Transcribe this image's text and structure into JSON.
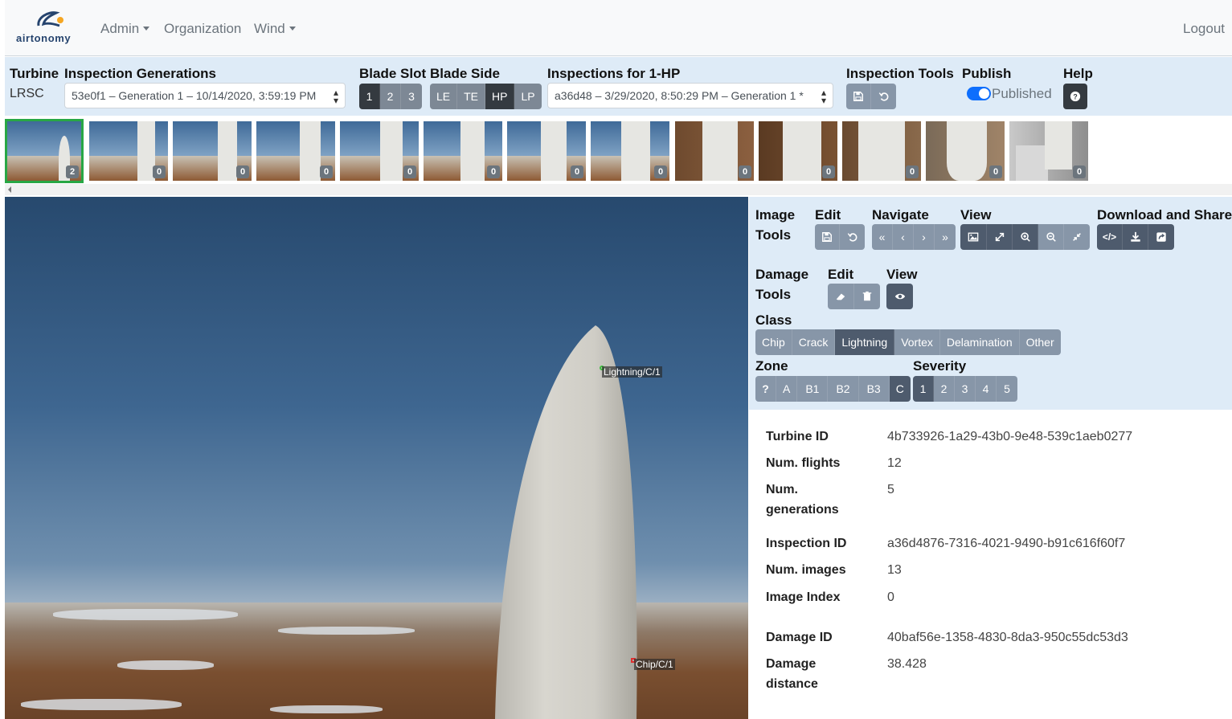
{
  "nav": {
    "logo_text": "airtonomy",
    "admin": "Admin",
    "organization": "Organization",
    "wind": "Wind",
    "logout": "Logout"
  },
  "toolbar": {
    "turbine_label": "Turbine",
    "turbine_value": "LRSC",
    "generations_label": "Inspection Generations",
    "generations_selected": "53e0f1 – Generation 1 – 10/14/2020, 3:59:19 PM",
    "blade_slot_label": "Blade Slot",
    "blade_slots": [
      "1",
      "2",
      "3"
    ],
    "blade_side_label": "Blade Side",
    "blade_sides": [
      "LE",
      "TE",
      "HP",
      "LP"
    ],
    "inspections_label": "Inspections for 1-HP",
    "inspection_selected": "a36d48 – 3/29/2020, 8:50:29 PM – Generation 1 *",
    "inspection_tools_label": "Inspection Tools",
    "publish_label": "Publish",
    "publish_state": "Published",
    "help_label": "Help"
  },
  "thumbnails": [
    {
      "count": "2"
    },
    {
      "count": "0"
    },
    {
      "count": "0"
    },
    {
      "count": "0"
    },
    {
      "count": "0"
    },
    {
      "count": "0"
    },
    {
      "count": "0"
    },
    {
      "count": "0"
    },
    {
      "count": "0"
    },
    {
      "count": "0"
    },
    {
      "count": "0"
    },
    {
      "count": "0"
    },
    {
      "count": "0"
    }
  ],
  "annotations": {
    "lightning": "Lightning/C/1",
    "chip": "Chip/C/1",
    "lightning_color": "#3fbf3f",
    "chip_color": "#e03030"
  },
  "tools": {
    "image_tools_line1": "Image",
    "image_tools_line2": "Tools",
    "edit": "Edit",
    "navigate": "Navigate",
    "view": "View",
    "download_share": "Download and Share",
    "damage_tools_line1": "Damage",
    "damage_tools_line2": "Tools",
    "damage_edit": "Edit",
    "damage_view": "View",
    "class_label": "Class",
    "classes": [
      "Chip",
      "Crack",
      "Lightning",
      "Vortex",
      "Delamination",
      "Other"
    ],
    "zone_label": "Zone",
    "zones": [
      "?",
      "A",
      "B1",
      "B2",
      "B3",
      "C"
    ],
    "severity_label": "Severity",
    "severities": [
      "1",
      "2",
      "3",
      "4",
      "5"
    ]
  },
  "info": {
    "turbine_id_label": "Turbine ID",
    "turbine_id": "4b733926-1a29-43b0-9e48-539c1aeb0277",
    "num_flights_label": "Num. flights",
    "num_flights": "12",
    "num_generations_label_1": "Num.",
    "num_generations_label_2": "generations",
    "num_generations": "5",
    "inspection_id_label": "Inspection ID",
    "inspection_id": "a36d4876-7316-4021-9490-b91c616f60f7",
    "num_images_label": "Num. images",
    "num_images": "13",
    "image_index_label": "Image Index",
    "image_index": "0",
    "damage_id_label": "Damage ID",
    "damage_id": "40baf56e-1358-4830-8da3-950c55dc53d3",
    "damage_distance_label_1": "Damage",
    "damage_distance_label_2": "distance",
    "damage_distance": "38.428"
  },
  "colors": {
    "accent": "#0d6efd",
    "panel_bg": "#deebf7",
    "active_thumb_border": "#28a745"
  }
}
